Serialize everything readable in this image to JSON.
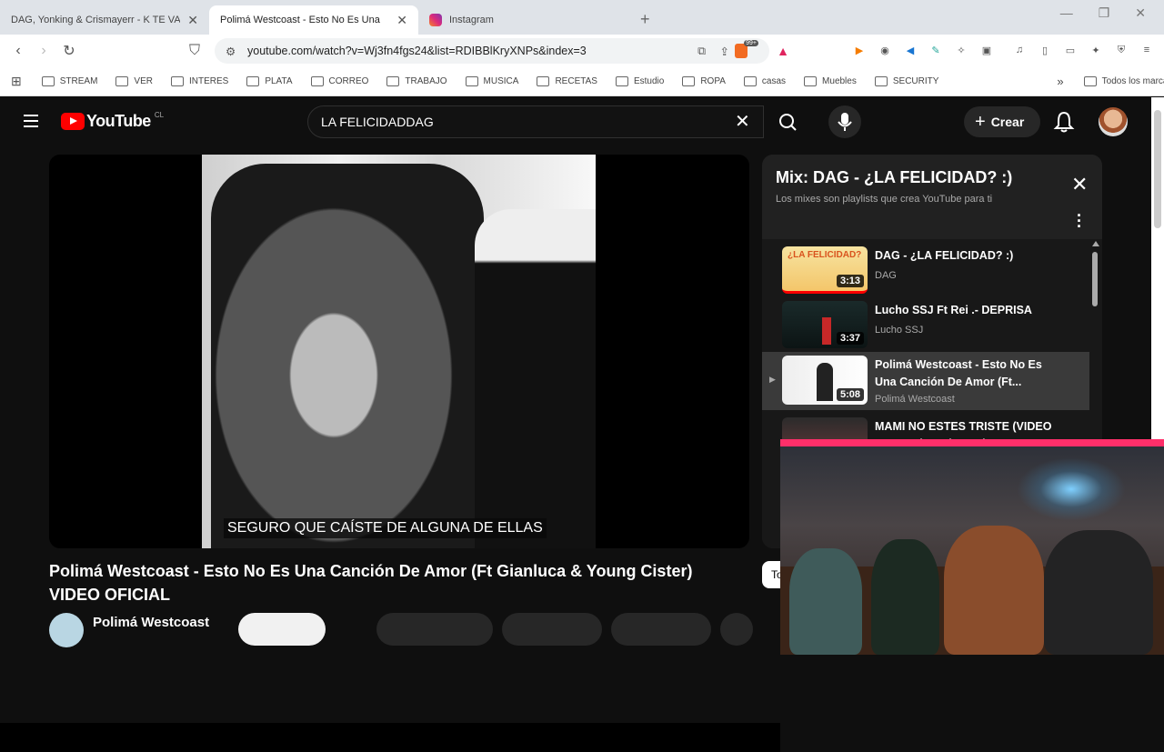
{
  "browser": {
    "tabs": [
      {
        "title": "DAG, Yonking & Crismayerr - K TE VAYA",
        "icon": "youtube-icon",
        "active": false
      },
      {
        "title": "Polimá Westcoast - Esto No Es Una",
        "icon": "youtube-icon",
        "active": true
      },
      {
        "title": "Instagram",
        "icon": "instagram-icon",
        "active": false
      }
    ],
    "url": "youtube.com/watch?v=Wj3fn4fgs24&list=RDIBBlKryXNPs&index=3",
    "badge_count": "99+",
    "bookmarks": [
      "STREAM",
      "VER",
      "INTERES",
      "PLATA",
      "CORREO",
      "TRABAJO",
      "MUSICA",
      "RECETAS",
      "Estudio",
      "ROPA",
      "casas",
      "Muebles",
      "SECURITY"
    ],
    "all_bookmarks": "Todos los marcadores"
  },
  "youtube": {
    "logo_text": "YouTube",
    "country": "CL",
    "search_value": "LA FELICIDADDAG",
    "create_label": "Crear",
    "subtitle": "SEGURO QUE CAÍSTE DE ALGUNA DE ELLAS",
    "video_title": "Polimá Westcoast - Esto No Es Una Canción De Amor (Ft Gianluca & Young Cister) VIDEO OFICIAL",
    "channel_name": "Polimá Westcoast",
    "side_pill": "To"
  },
  "playlist": {
    "title": "Mix: DAG - ¿LA FELICIDAD? :)",
    "subtitle": "Los mixes son playlists que crea YouTube para ti",
    "items": [
      {
        "title": "DAG - ¿LA FELICIDAD? :)",
        "channel": "DAG",
        "duration": "3:13",
        "thumb_text": "¿LA FELICIDAD?",
        "current": false
      },
      {
        "title": "Lucho SSJ Ft Rei .- DEPRISA",
        "channel": "Lucho SSJ",
        "duration": "3:37",
        "current": false
      },
      {
        "title": "Polimá Westcoast - Esto No Es Una Canción De Amor (Ft...",
        "channel": "Polimá Westcoast",
        "duration": "5:08",
        "current": true
      },
      {
        "title": "MAMI NO ESTES TRISTE (VIDEO OFICIAL) - Celas Cele",
        "channel": "",
        "duration": "",
        "current": false
      }
    ]
  },
  "colors": {
    "yt_red": "#ff0000",
    "bg": "#0f0f0f",
    "panel": "#212121"
  }
}
